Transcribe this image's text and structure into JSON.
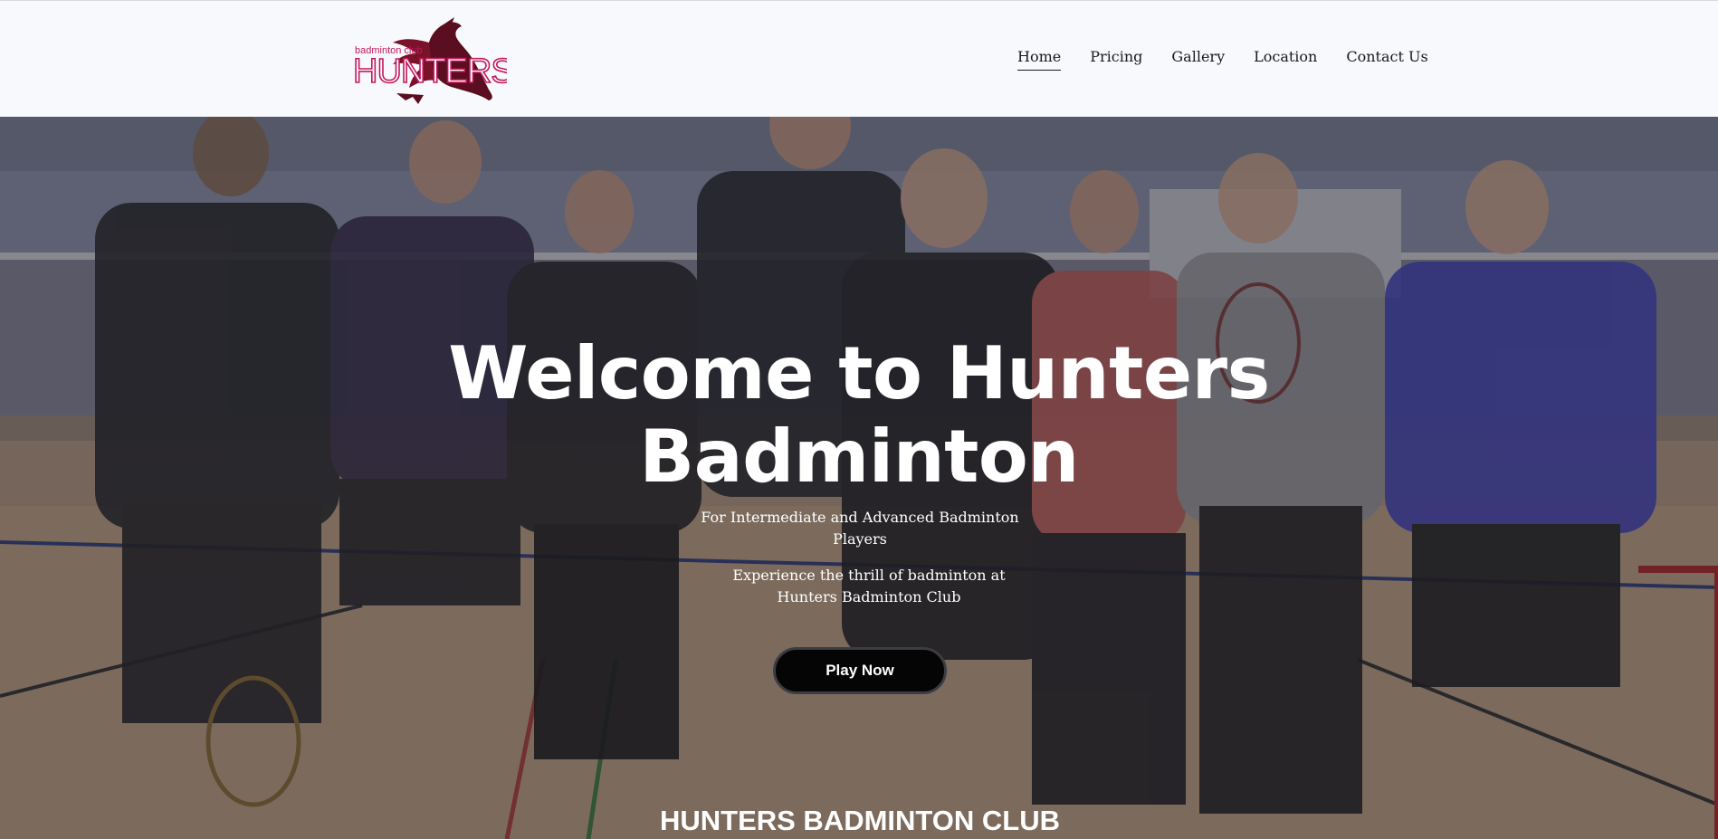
{
  "brand": {
    "small_text": "badminton club",
    "name": "HUNTERS",
    "colors": {
      "primary": "#8a1538",
      "dark": "#5a0e1f",
      "accent": "#c2185b"
    }
  },
  "nav": {
    "items": [
      {
        "label": "Home",
        "active": true
      },
      {
        "label": "Pricing",
        "active": false
      },
      {
        "label": "Gallery",
        "active": false
      },
      {
        "label": "Location",
        "active": false
      },
      {
        "label": "Contact Us",
        "active": false
      }
    ]
  },
  "hero": {
    "title_line1": "Welcome to Hunters",
    "title_line2": "Badminton",
    "subtitle_1": "For Intermediate and Advanced  Badminton Players",
    "subtitle_2": "Experience the thrill of badminton at Hunters Badminton Club",
    "cta_label": "Play Now",
    "next_section_heading": "HUNTERS BADMINTON CLUB"
  }
}
